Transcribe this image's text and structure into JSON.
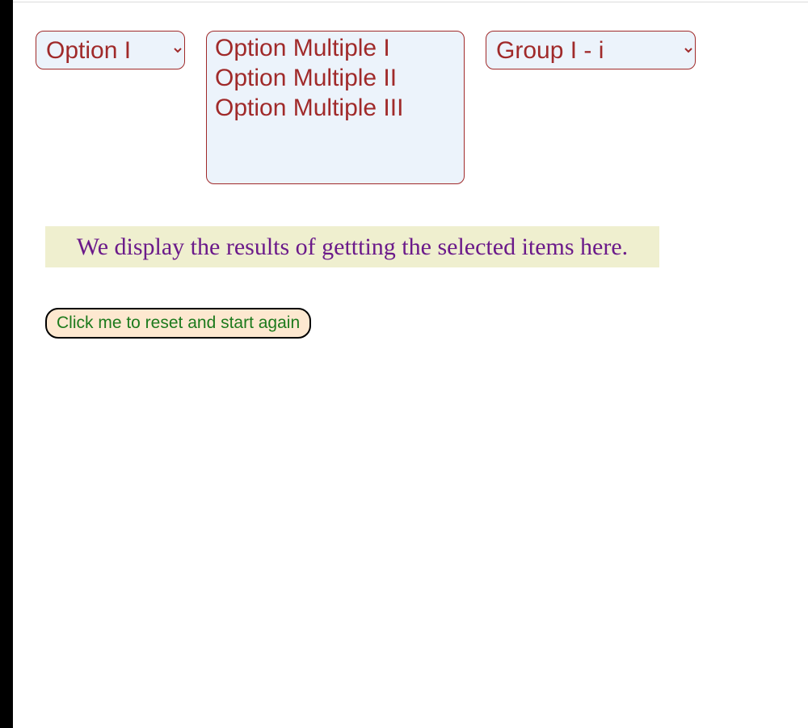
{
  "select_single": {
    "selected": "Option I",
    "options": [
      "Option I"
    ]
  },
  "select_multiple": {
    "options": [
      "Option Multiple I",
      "Option Multiple II",
      "Option Multiple III"
    ]
  },
  "select_grouped": {
    "selected": "Group I - i",
    "options": [
      "Group I - i"
    ]
  },
  "results_text": "We display the results of gettting the selected items here.",
  "reset_button_label": "Click me to reset and start again"
}
